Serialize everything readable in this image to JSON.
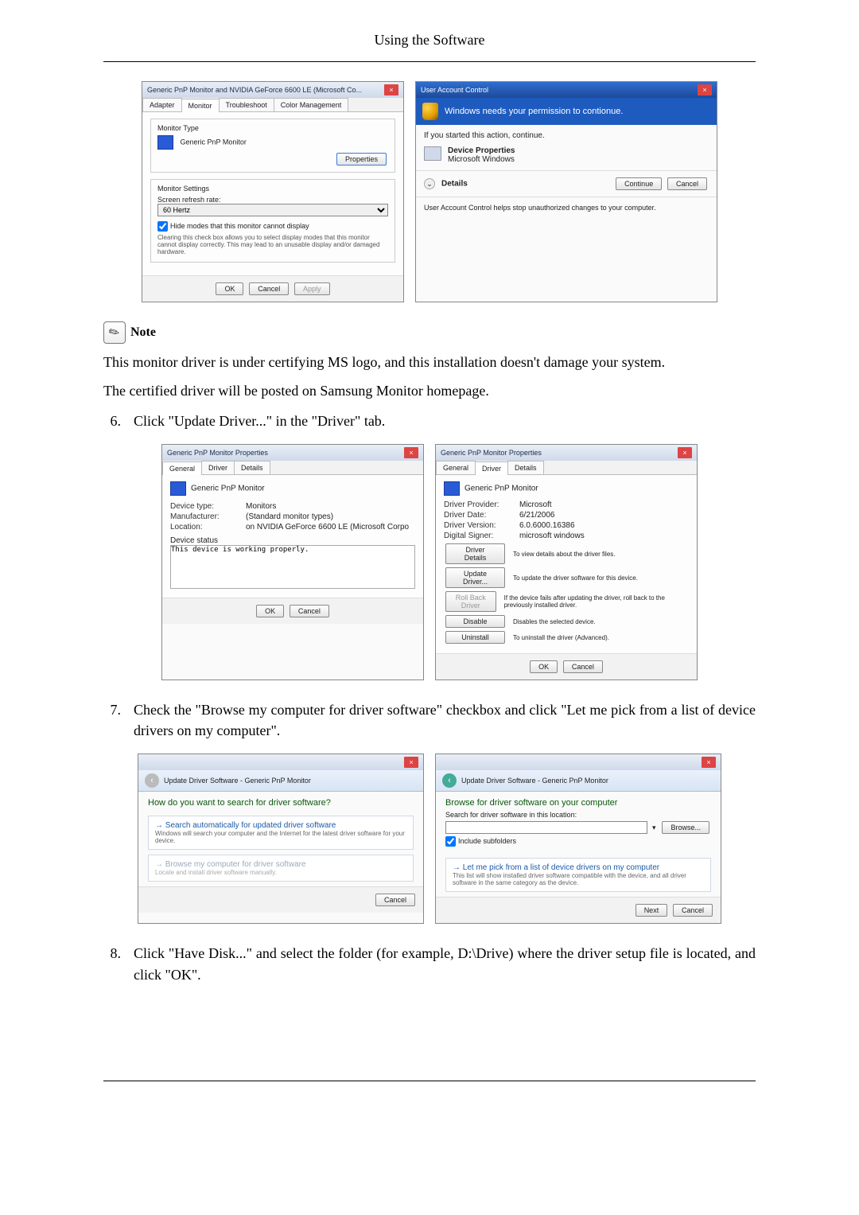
{
  "header_title": "Using the Software",
  "shot1_left": {
    "title": "Generic PnP Monitor and NVIDIA GeForce 6600 LE (Microsoft Co...",
    "tabs": [
      "Adapter",
      "Monitor",
      "Troubleshoot",
      "Color Management"
    ],
    "active_tab": "Monitor",
    "monitor_type_label": "Monitor Type",
    "monitor_name": "Generic PnP Monitor",
    "properties_btn": "Properties",
    "monitor_settings_label": "Monitor Settings",
    "refresh_label": "Screen refresh rate:",
    "refresh_value": "60 Hertz",
    "hide_modes_label": "Hide modes that this monitor cannot display",
    "hide_modes_desc": "Clearing this check box allows you to select display modes that this monitor cannot display correctly. This may lead to an unusable display and/or damaged hardware.",
    "ok": "OK",
    "cancel": "Cancel",
    "apply": "Apply"
  },
  "shot1_right": {
    "title": "User Account Control",
    "banner": "Windows needs your permission to contionue.",
    "started": "If you started this action, continue.",
    "item_title": "Device Properties",
    "item_sub": "Microsoft Windows",
    "details": "Details",
    "continue": "Continue",
    "cancel": "Cancel",
    "help": "User Account Control helps stop unauthorized changes to your computer."
  },
  "note_label": "Note",
  "note_line1": "This monitor driver is under certifying MS logo, and this installation doesn't damage your system.",
  "note_line2": "The certified driver will be posted on Samsung Monitor homepage.",
  "step6": {
    "num": "6.",
    "text": "Click \"Update Driver...\" in the \"Driver\" tab."
  },
  "shot2_left": {
    "title": "Generic PnP Monitor Properties",
    "tabs": [
      "General",
      "Driver",
      "Details"
    ],
    "active_tab": "General",
    "monitor_name": "Generic PnP Monitor",
    "k_devtype": "Device type:",
    "v_devtype": "Monitors",
    "k_mfr": "Manufacturer:",
    "v_mfr": "(Standard monitor types)",
    "k_loc": "Location:",
    "v_loc": "on NVIDIA GeForce 6600 LE (Microsoft Corpo",
    "status_label": "Device status",
    "status_text": "This device is working properly.",
    "ok": "OK",
    "cancel": "Cancel"
  },
  "shot2_right": {
    "title": "Generic PnP Monitor Properties",
    "tabs": [
      "General",
      "Driver",
      "Details"
    ],
    "active_tab": "Driver",
    "monitor_name": "Generic PnP Monitor",
    "k_prov": "Driver Provider:",
    "v_prov": "Microsoft",
    "k_date": "Driver Date:",
    "v_date": "6/21/2006",
    "k_ver": "Driver Version:",
    "v_ver": "6.0.6000.16386",
    "k_sign": "Digital Signer:",
    "v_sign": "microsoft windows",
    "b_details": "Driver Details",
    "d_details": "To view details about the driver files.",
    "b_update": "Update Driver...",
    "d_update": "To update the driver software for this device.",
    "b_rollback": "Roll Back Driver",
    "d_rollback": "If the device fails after updating the driver, roll back to the previously installed driver.",
    "b_disable": "Disable",
    "d_disable": "Disables the selected device.",
    "b_uninstall": "Uninstall",
    "d_uninstall": "To uninstall the driver (Advanced).",
    "ok": "OK",
    "cancel": "Cancel"
  },
  "step7": {
    "num": "7.",
    "text": "Check the \"Browse my computer for driver software\" checkbox and click \"Let me pick from a list of device drivers on my computer\"."
  },
  "shot3_left": {
    "crumb": "Update Driver Software - Generic PnP Monitor",
    "question": "How do you want to search for driver software?",
    "opt1_title": "Search automatically for updated driver software",
    "opt1_desc": "Windows will search your computer and the Internet for the latest driver software for your device.",
    "opt2_title": "Browse my computer for driver software",
    "opt2_desc": "Locate and install driver software manually.",
    "cancel": "Cancel"
  },
  "shot3_right": {
    "crumb": "Update Driver Software - Generic PnP Monitor",
    "heading": "Browse for driver software on your computer",
    "search_label": "Search for driver software in this location:",
    "browse": "Browse...",
    "include_sub": "Include subfolders",
    "opt_title": "Let me pick from a list of device drivers on my computer",
    "opt_desc": "This list will show installed driver software compatible with the device, and all driver software in the same category as the device.",
    "next": "Next",
    "cancel": "Cancel"
  },
  "step8": {
    "num": "8.",
    "text": "Click \"Have Disk...\" and select the folder (for example, D:\\Drive) where the driver setup file is located, and click \"OK\"."
  }
}
